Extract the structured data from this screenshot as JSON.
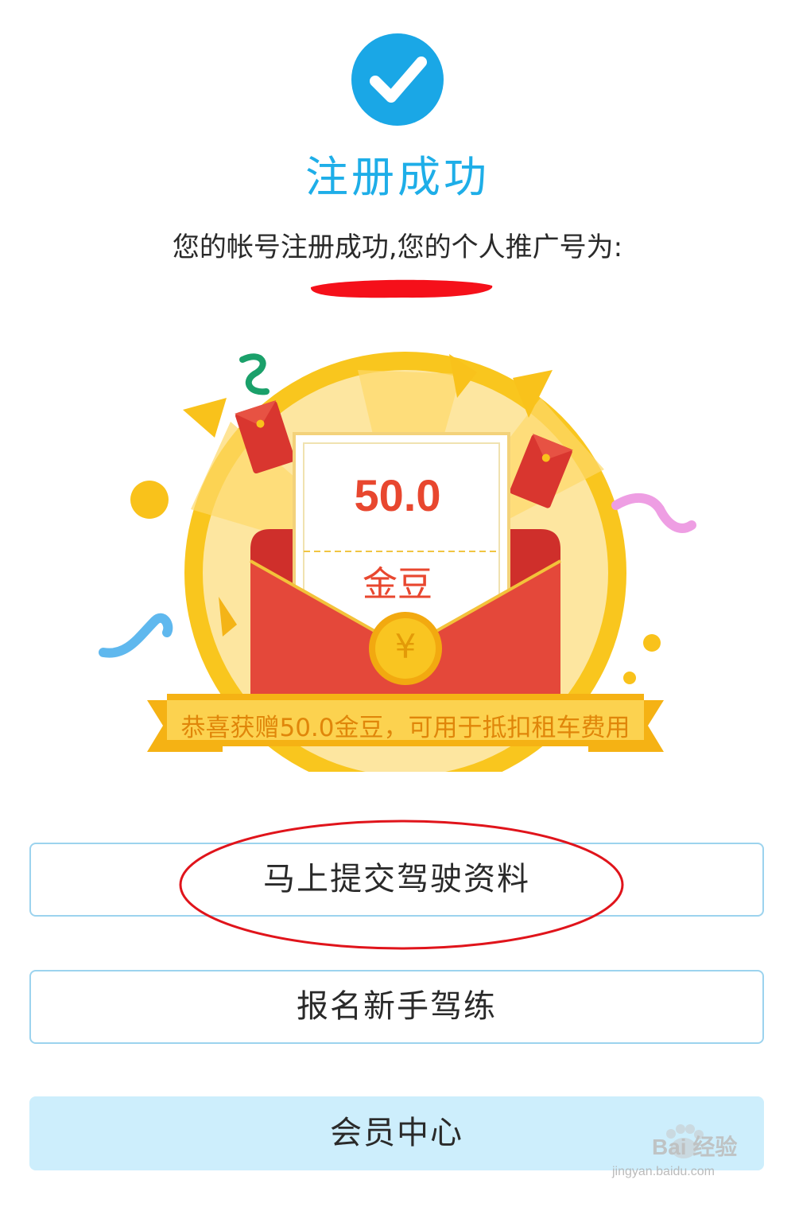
{
  "header": {
    "title": "注册成功",
    "message": "您的帐号注册成功,您的个人推广号为:"
  },
  "reward": {
    "amount": "50.0",
    "unit": "金豆",
    "coin_symbol": "¥",
    "banner": "恭喜获赠50.0金豆，可用于抵扣租车费用"
  },
  "actions": {
    "submit_driving_info": "马上提交驾驶资料",
    "enroll_novice_training": "报名新手驾练",
    "member_center": "会员中心"
  },
  "watermark": {
    "brand": "Bai 经验",
    "url": "jingyan.baidu.com"
  },
  "colors": {
    "accent_blue": "#1eaee8",
    "button_border": "#9cd3ee",
    "member_button_bg": "#cdeefc",
    "envelope_red": "#e34a36",
    "gold": "#f7c21c",
    "annotation_red": "#e0141b"
  }
}
